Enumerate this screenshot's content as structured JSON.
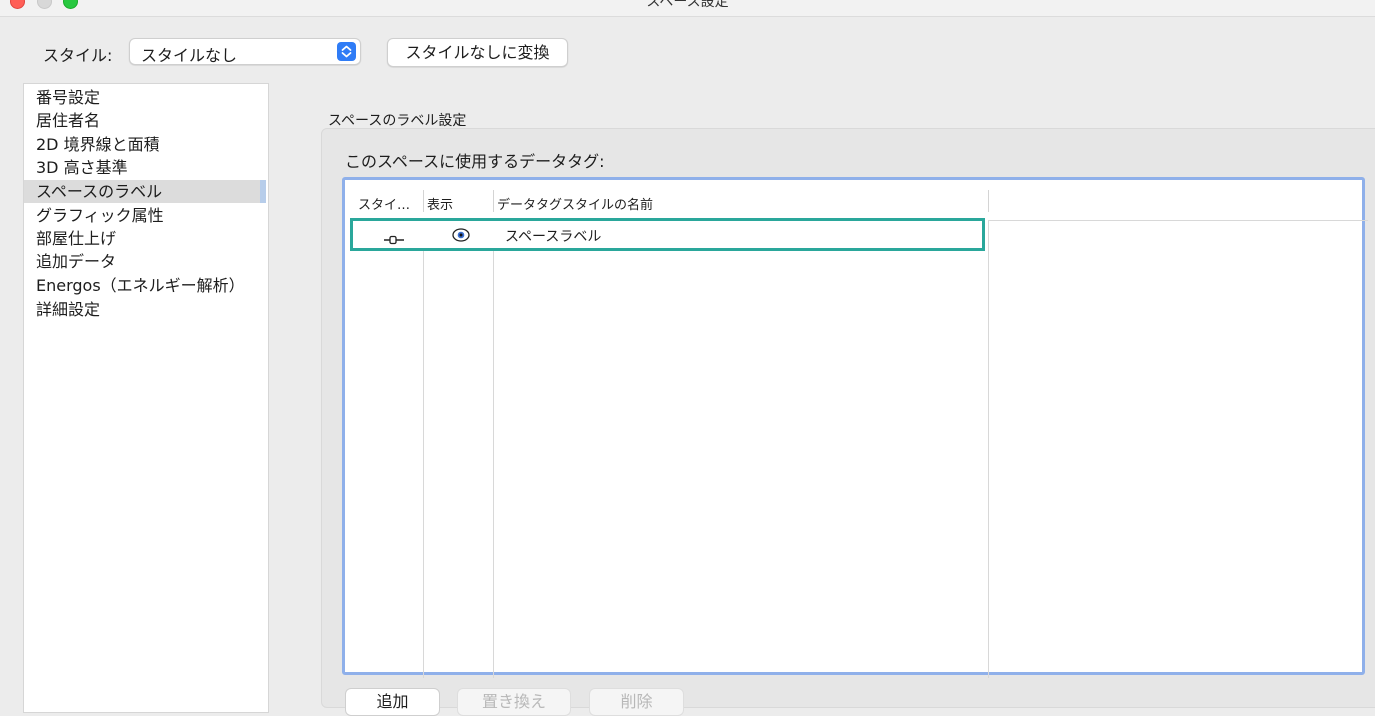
{
  "window": {
    "title": "スペース設定"
  },
  "style_selector": {
    "label": "スタイル:",
    "value": "スタイルなし",
    "convert_button": "スタイルなしに変換"
  },
  "sidebar": {
    "items": [
      {
        "label": "番号設定"
      },
      {
        "label": "居住者名"
      },
      {
        "label": "2D 境界線と面積"
      },
      {
        "label": "3D 高さ基準"
      },
      {
        "label": "スペースのラベル",
        "selected": true
      },
      {
        "label": "グラフィック属性"
      },
      {
        "label": "部屋仕上げ"
      },
      {
        "label": "追加データ"
      },
      {
        "label": "Energos（エネルギー解析）"
      },
      {
        "label": "詳細設定"
      }
    ]
  },
  "main": {
    "section_label": "スペースのラベル設定",
    "group_header": "このスペースに使用するデータタグ:",
    "table": {
      "columns": [
        "スタイ…",
        "表示",
        "データタグスタイルの名前"
      ],
      "rows": [
        {
          "style_icon": "slider-icon",
          "visible_icon": "eye-icon",
          "name": "スペースラベル"
        }
      ]
    },
    "buttons": {
      "add": "追加",
      "replace": "置き換え",
      "delete": "削除"
    }
  },
  "colors": {
    "accent_blue": "#2f7cf6",
    "selection_teal": "#2aa79b",
    "table_focus": "#8fb0ea"
  }
}
